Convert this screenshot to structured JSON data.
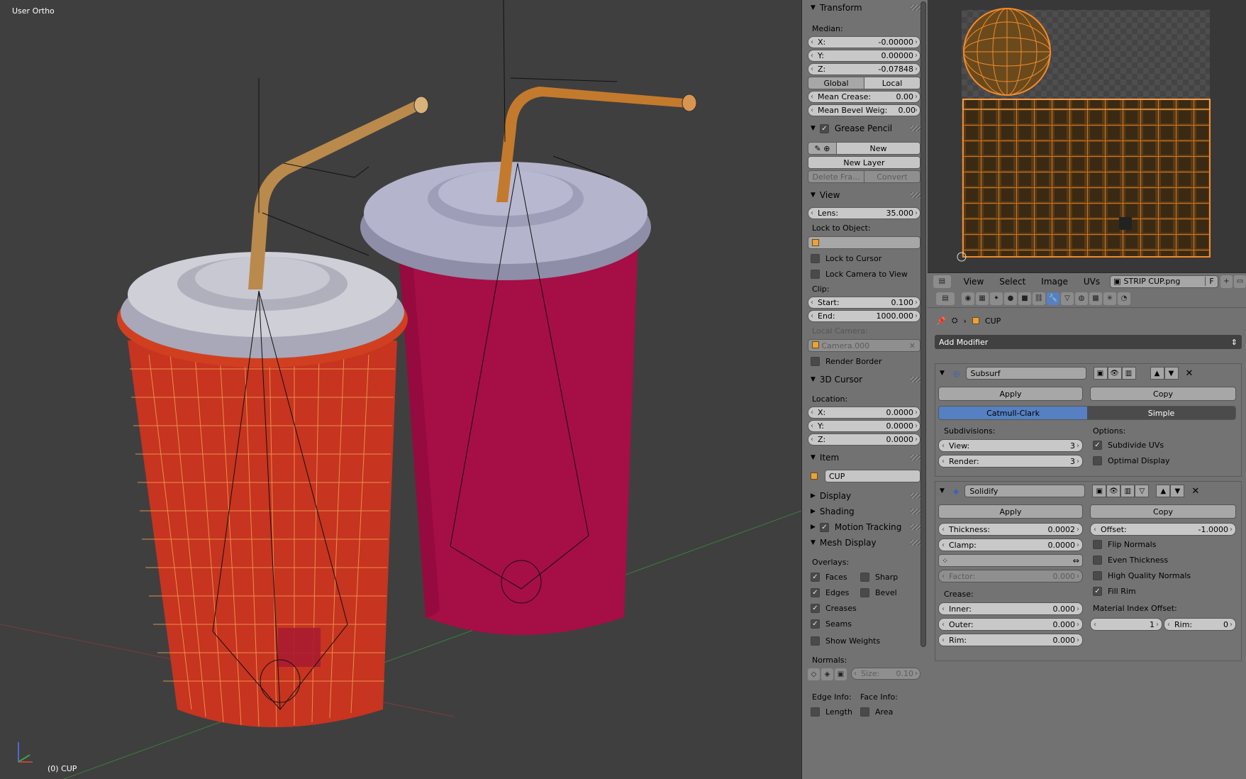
{
  "viewport": {
    "view_name": "User Ortho",
    "object_label": "(0) CUP",
    "colors": {
      "cup_red": "#c8341f",
      "cup_pink": "#b0104a",
      "lid": "#a8a8c0",
      "straw": "#c98a3c",
      "background": "#3f3f3f"
    }
  },
  "npanel": {
    "transform": {
      "title": "Transform",
      "median_label": "Median:",
      "x_label": "X:",
      "x": "-0.00000",
      "y_label": "Y:",
      "y": "0.00000",
      "z_label": "Z:",
      "z": "-0.07848",
      "global": "Global",
      "local": "Local",
      "mean_crease_label": "Mean Crease:",
      "mean_crease": "0.00",
      "mean_bevel_label": "Mean Bevel Weig:",
      "mean_bevel": "0.00"
    },
    "grease_pencil": {
      "title": "Grease Pencil",
      "new": "New",
      "new_layer": "New Layer",
      "delete_frame": "Delete Fra...",
      "convert": "Convert"
    },
    "view": {
      "title": "View",
      "lens_label": "Lens:",
      "lens": "35.000",
      "lock_to_object": "Lock to Object:",
      "lock_to_cursor": "Lock to Cursor",
      "lock_camera": "Lock Camera to View",
      "clip": "Clip:",
      "start_label": "Start:",
      "start": "0.100",
      "end_label": "End:",
      "end": "1000.000",
      "local_camera": "Local Camera:",
      "camera_value": "Camera.000",
      "render_border": "Render Border"
    },
    "cursor": {
      "title": "3D Cursor",
      "location": "Location:",
      "x_label": "X:",
      "x": "0.0000",
      "y_label": "Y:",
      "y": "0.0000",
      "z_label": "Z:",
      "z": "0.0000"
    },
    "item": {
      "title": "Item",
      "name": "CUP"
    },
    "display": "Display",
    "shading": "Shading",
    "motion_tracking": "Motion Tracking",
    "mesh_display": {
      "title": "Mesh Display",
      "overlays": "Overlays:",
      "faces": "Faces",
      "sharp": "Sharp",
      "edges": "Edges",
      "bevel": "Bevel",
      "creases": "Creases",
      "seams": "Seams",
      "show_weights": "Show Weights",
      "normals": "Normals:",
      "size_label": "Size:",
      "size": "0.10",
      "edge_info": "Edge Info:",
      "face_info": "Face Info:",
      "length": "Length",
      "area": "Area"
    }
  },
  "uv_editor": {
    "menus": [
      "View",
      "Select",
      "Image",
      "UVs"
    ],
    "image_name": "STRIP CUP.png",
    "fake_user": "F"
  },
  "properties": {
    "object_name": "CUP",
    "add_modifier": "Add Modifier",
    "subsurf": {
      "name": "Subsurf",
      "apply": "Apply",
      "copy": "Copy",
      "catmull": "Catmull-Clark",
      "simple": "Simple",
      "subdivisions": "Subdivisions:",
      "options": "Options:",
      "view_label": "View:",
      "view": "3",
      "render_label": "Render:",
      "render": "3",
      "subdivide_uvs": "Subdivide UVs",
      "optimal_display": "Optimal Display"
    },
    "solidify": {
      "name": "Solidify",
      "apply": "Apply",
      "copy": "Copy",
      "thickness_label": "Thickness:",
      "thickness": "0.0002",
      "offset_label": "Offset:",
      "offset": "-1.0000",
      "clamp_label": "Clamp:",
      "clamp": "0.0000",
      "flip_normals": "Flip Normals",
      "even_thickness": "Even Thickness",
      "high_quality": "High Quality Normals",
      "fill_rim": "Fill Rim",
      "factor_label": "Factor:",
      "factor": "0.000",
      "crease": "Crease:",
      "material_index": "Material Index Offset:",
      "inner_label": "Inner:",
      "inner": "0.000",
      "outer_label": "Outer:",
      "outer": "0.000",
      "mat_value": "1",
      "rim_label": "Rim:",
      "rim_value": "0",
      "rim2_label": "Rim:",
      "rim2": "0.000"
    }
  }
}
